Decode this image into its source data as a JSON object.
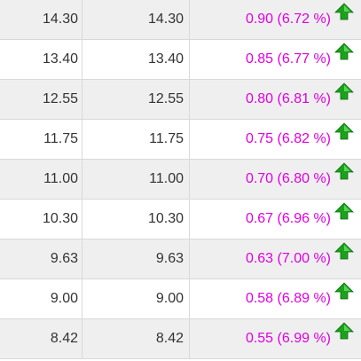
{
  "rows": [
    {
      "col1": "14.30",
      "col2": "14.30",
      "change": "0.90 (6.72 %)",
      "direction": "up-arrow-icon"
    },
    {
      "col1": "13.40",
      "col2": "13.40",
      "change": "0.85 (6.77 %)",
      "direction": "up-arrow-icon"
    },
    {
      "col1": "12.55",
      "col2": "12.55",
      "change": "0.80 (6.81 %)",
      "direction": "up-arrow-icon"
    },
    {
      "col1": "11.75",
      "col2": "11.75",
      "change": "0.75 (6.82 %)",
      "direction": "up-arrow-icon"
    },
    {
      "col1": "11.00",
      "col2": "11.00",
      "change": "0.70 (6.80 %)",
      "direction": "up-arrow-icon"
    },
    {
      "col1": "10.30",
      "col2": "10.30",
      "change": "0.67 (6.96 %)",
      "direction": "up-arrow-icon"
    },
    {
      "col1": "9.63",
      "col2": "9.63",
      "change": "0.63 (7.00 %)",
      "direction": "up-arrow-icon"
    },
    {
      "col1": "9.00",
      "col2": "9.00",
      "change": "0.58 (6.89 %)",
      "direction": "up-arrow-icon"
    },
    {
      "col1": "8.42",
      "col2": "8.42",
      "change": "0.55 (6.99 %)",
      "direction": "up-arrow-icon"
    }
  ],
  "colors": {
    "change_text": "#e000e0",
    "arrow_green": "#1aa31a",
    "row_shade": "#efefef"
  }
}
